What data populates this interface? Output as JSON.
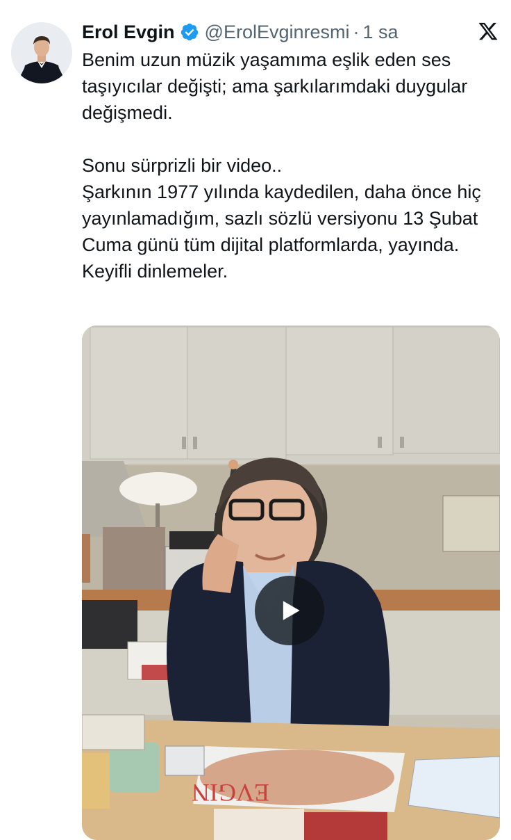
{
  "tweet": {
    "author_name": "Erol Evgin",
    "handle": "@ErolEvginresmi",
    "separator": "·",
    "time": "1 sa",
    "text": "Benim uzun müzik yaşamıma eşlik eden ses taşıyıcılar değişti; ama şarkılarımdaki duygular değişmedi.\n\nSonu sürprizli bir video..\nŞarkının 1977 yılında kaydedilen, daha önce hiç yayınlamadığım, sazlı sözlü versiyonu 13 Şubat Cuma günü tüm dijital platformlarda, yayında.\nKeyifli dinlemeler."
  },
  "media": {
    "type": "video",
    "album_cover_text": "EVGIN"
  },
  "icons": {
    "verified": "verified-badge-icon",
    "platform": "x-logo-icon",
    "play": "play-icon"
  },
  "colors": {
    "verified_blue": "#1d9bf0",
    "text_primary": "#0f1419",
    "text_secondary": "#536471",
    "play_overlay": "#0f1419"
  }
}
